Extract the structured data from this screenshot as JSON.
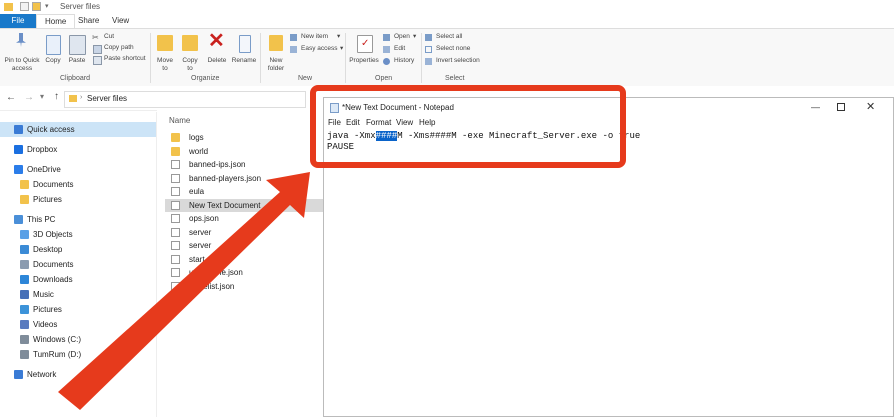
{
  "window": {
    "title": "Server files"
  },
  "ribbon_tabs": [
    "File",
    "Home",
    "Share",
    "View"
  ],
  "ribbon": {
    "clipboard": {
      "pin_label": "Pin to Quick access",
      "copy_label": "Copy",
      "paste_label": "Paste",
      "cut_label": "Cut",
      "copy_path_label": "Copy path",
      "paste_shortcut_label": "Paste shortcut",
      "group_label": "Clipboard"
    },
    "organize": {
      "move_to_label": "Move to",
      "copy_to_label": "Copy to",
      "delete_label": "Delete",
      "rename_label": "Rename",
      "group_label": "Organize"
    },
    "new": {
      "new_folder_label": "New folder",
      "new_item_label": "New item",
      "easy_access_label": "Easy access",
      "group_label": "New"
    },
    "open": {
      "properties_label": "Properties",
      "open_label": "Open",
      "edit_label": "Edit",
      "history_label": "History",
      "group_label": "Open"
    },
    "select": {
      "select_all_label": "Select all",
      "select_none_label": "Select none",
      "invert_selection_label": "Invert selection",
      "group_label": "Select"
    }
  },
  "address": {
    "path": "Server files"
  },
  "nav": {
    "items": [
      {
        "label": "Quick access",
        "icon": "star-icon"
      },
      {
        "label": "Dropbox",
        "icon": "dropbox-icon"
      },
      {
        "label": "OneDrive",
        "icon": "cloud-icon"
      },
      {
        "label": "Documents",
        "icon": "folder-icon"
      },
      {
        "label": "Pictures",
        "icon": "folder-icon"
      },
      {
        "label": "This PC",
        "icon": "computer-icon"
      },
      {
        "label": "3D Objects",
        "icon": "cube-icon"
      },
      {
        "label": "Desktop",
        "icon": "desktop-icon"
      },
      {
        "label": "Documents",
        "icon": "documents-icon"
      },
      {
        "label": "Downloads",
        "icon": "download-icon"
      },
      {
        "label": "Music",
        "icon": "music-icon"
      },
      {
        "label": "Pictures",
        "icon": "pictures-icon"
      },
      {
        "label": "Videos",
        "icon": "video-icon"
      },
      {
        "label": "Windows (C:)",
        "icon": "drive-icon"
      },
      {
        "label": "TumRum (D:)",
        "icon": "drive-icon"
      },
      {
        "label": "Network",
        "icon": "network-icon"
      }
    ]
  },
  "files": {
    "header": "Name",
    "items": [
      {
        "name": "logs",
        "type": "folder"
      },
      {
        "name": "world",
        "type": "folder"
      },
      {
        "name": "banned-ips.json",
        "type": "file"
      },
      {
        "name": "banned-players.json",
        "type": "file"
      },
      {
        "name": "eula",
        "type": "file"
      },
      {
        "name": "New Text Document",
        "type": "file"
      },
      {
        "name": "ops.json",
        "type": "file"
      },
      {
        "name": "server",
        "type": "file"
      },
      {
        "name": "server",
        "type": "file"
      },
      {
        "name": "start",
        "type": "file"
      },
      {
        "name": "usercache.json",
        "type": "file"
      },
      {
        "name": "whitelist.json",
        "type": "file"
      }
    ]
  },
  "notepad": {
    "title": "*New Text Document - Notepad",
    "menu": [
      "File",
      "Edit",
      "Format",
      "View",
      "Help"
    ],
    "line1_before": "java -Xmx",
    "line1_selected": "####",
    "line1_after": "M -Xms####M -exe Minecraft_Server.exe -o true",
    "line2": "PAUSE"
  },
  "colors": {
    "accent": "#1979ca",
    "annotation": "#e63a1c",
    "selection": "#0a63c9"
  }
}
